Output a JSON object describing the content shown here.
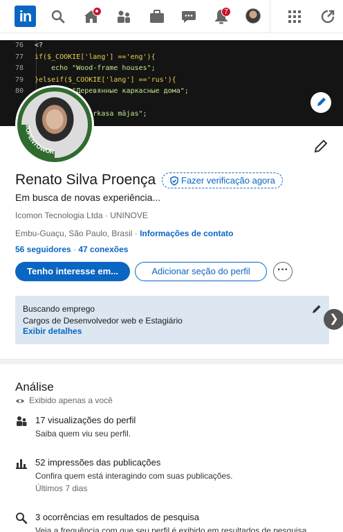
{
  "nav": {
    "logo_text": "in",
    "icons": [
      "search-icon",
      "home-icon",
      "my-network-icon",
      "jobs-icon",
      "messaging-icon",
      "notifications-icon",
      "me-avatar",
      "apps-grid-icon",
      "advertise-icon"
    ],
    "notifications_badge": "7"
  },
  "banner": {
    "code_lines": [
      {
        "n": "76",
        "text": "<?"
      },
      {
        "n": "77",
        "text": "if($_COOKIE['lang'] =='eng'){"
      },
      {
        "n": "78",
        "text": "    echo \"Wood-frame houses\";"
      },
      {
        "n": "79",
        "text": "}elseif($_COOKIE['lang'] =='rus'){"
      },
      {
        "n": "80",
        "text": "    echo \"Деревянные каркасные дома\";"
      },
      {
        "n": "",
        "text": ""
      },
      {
        "n": "",
        "text": "       Koka karkasa mājas\";"
      }
    ]
  },
  "profile": {
    "open_to_work_label": "#OPENTOWORK",
    "name": "Renato Silva Proença",
    "verify_label": "Fazer verificação agora",
    "headline": "Em busca de novas experiência...",
    "company": "Icomon Tecnologia Ltda · UNINOVE",
    "location": "Embu-Guaçu, São Paulo, Brasil · ",
    "contact_info": "Informações de contato",
    "followers": "56 seguidores",
    "separator": " · ",
    "connections": "47 conexões",
    "primary_button": "Tenho interesse em...",
    "secondary_button": "Adicionar seção do perfil",
    "more_button": "···"
  },
  "open_to_work_card": {
    "title": "Buscando emprego",
    "roles": "Cargos de Desenvolvedor web e Estagiário",
    "details_link": "Exibir detalhes",
    "next_arrow": "❯"
  },
  "analytics": {
    "title": "Análise",
    "privacy": "Exibido apenas a você",
    "items": [
      {
        "title": "17 visualizações do perfil",
        "sub": "Saiba quem viu seu perfil.",
        "note": "",
        "icon": "people-icon"
      },
      {
        "title": "52 impressões das publicações",
        "sub": "Confira quem está interagindo com suas publicações.",
        "note": "Últimos 7 dias",
        "icon": "bar-chart-icon"
      },
      {
        "title": "3 ocorrências em resultados de pesquisa",
        "sub": "Veja a frequência com que seu perfil é exibido em resultados de pesquisa.",
        "note": "",
        "icon": "search-icon"
      }
    ]
  },
  "colors": {
    "brand": "#0a66c2",
    "open_to_work_green": "#2f6b2f",
    "badge_red": "#cb112d",
    "card_bg": "#dde7f1"
  }
}
